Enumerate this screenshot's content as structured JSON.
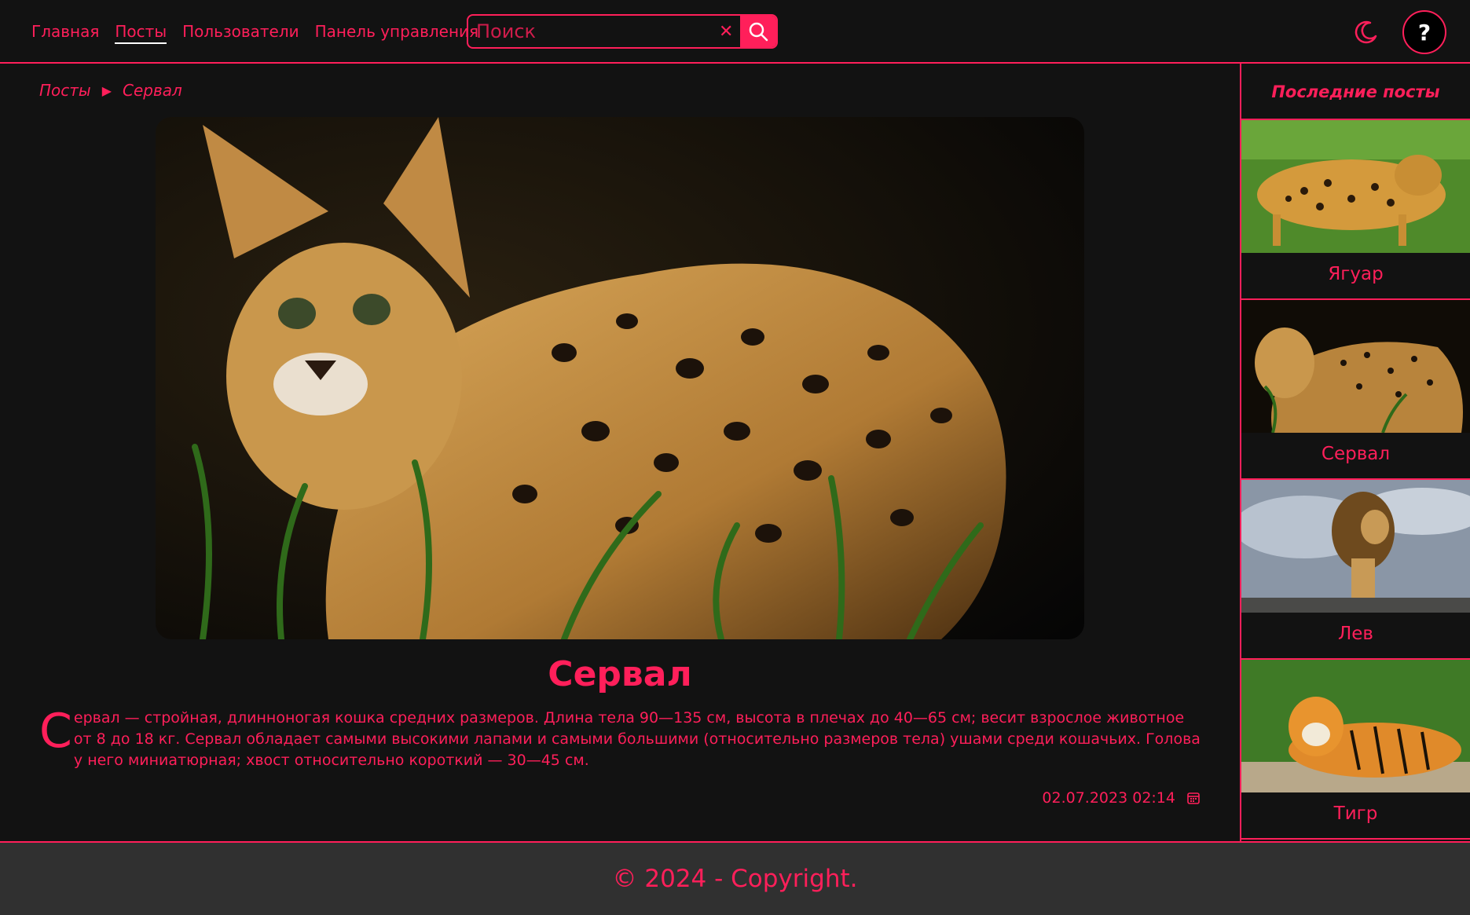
{
  "nav": {
    "items": [
      {
        "label": "Главная"
      },
      {
        "label": "Посты"
      },
      {
        "label": "Пользователи"
      },
      {
        "label": "Панель управления"
      }
    ]
  },
  "search": {
    "placeholder": "Поиск",
    "clear_icon": "close-icon",
    "button_icon": "search-icon"
  },
  "header": {
    "theme_icon": "moon-icon",
    "help_label": "?"
  },
  "breadcrumb": {
    "root": "Посты",
    "separator": "▶",
    "current": "Сервал"
  },
  "post": {
    "title": "Сервал",
    "dropcap": "С",
    "body": "ервал — стройная, длинноногая кошка средних размеров. Длина тела 90—135 см, высота в плечах до 40—65 см; весит взрослое животное от 8 до 18 кг. Сервал обладает самыми высокими лапами и самыми большими (относительно размеров тела) ушами среди кошачьих. Голова у него миниатюрная; хвост относительно короткий — 30—45 см.",
    "date": "02.07.2023 02:14",
    "date_icon": "calendar-icon"
  },
  "sidebar": {
    "title": "Последние посты",
    "posts": [
      {
        "name": "Ягуар"
      },
      {
        "name": "Сервал"
      },
      {
        "name": "Лев"
      },
      {
        "name": "Тигр"
      }
    ]
  },
  "footer": {
    "text": "© 2024 - Copyright."
  },
  "colors": {
    "accent": "#ff1f5a",
    "background": "#121212",
    "footer_bg": "#303030"
  }
}
